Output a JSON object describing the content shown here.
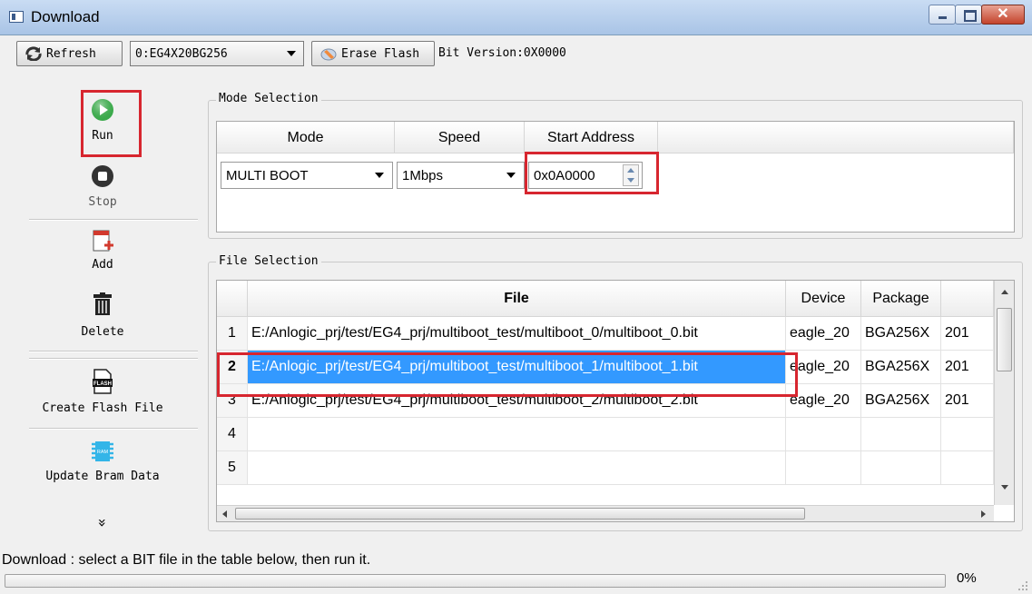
{
  "window": {
    "title": "Download"
  },
  "toolbar": {
    "refresh_label": "Refresh",
    "device_combo_value": "0:EG4X20BG256",
    "erase_label": "Erase Flash",
    "bit_version": "Bit Version:0X0000"
  },
  "sidebar": {
    "run": "Run",
    "stop": "Stop",
    "add": "Add",
    "delete": "Delete",
    "create_flash": "Create Flash File",
    "flash_icon_text": "FLASH",
    "update_bram": "Update Bram Data",
    "ram_icon_text": "RAM",
    "more": "»"
  },
  "mode_selection": {
    "title": "Mode Selection",
    "headers": {
      "mode": "Mode",
      "speed": "Speed",
      "start_address": "Start Address"
    },
    "mode_value": "MULTI BOOT",
    "speed_value": "1Mbps",
    "address_value": "0x0A0000"
  },
  "file_selection": {
    "title": "File Selection",
    "headers": {
      "file": "File",
      "device": "Device",
      "package": "Package",
      "extra": ""
    },
    "rows": [
      {
        "n": "1",
        "file": "E:/Anlogic_prj/test/EG4_prj/multiboot_test/multiboot_0/multiboot_0.bit",
        "device": "eagle_20",
        "package": "BGA256X",
        "extra": "201"
      },
      {
        "n": "2",
        "file": "E:/Anlogic_prj/test/EG4_prj/multiboot_test/multiboot_1/multiboot_1.bit",
        "device": "eagle_20",
        "package": "BGA256X",
        "extra": "201"
      },
      {
        "n": "3",
        "file": "E:/Anlogic_prj/test/EG4_prj/multiboot_test/multiboot_2/multiboot_2.bit",
        "device": "eagle_20",
        "package": "BGA256X",
        "extra": "201"
      },
      {
        "n": "4",
        "file": "",
        "device": "",
        "package": "",
        "extra": ""
      },
      {
        "n": "5",
        "file": "",
        "device": "",
        "package": "",
        "extra": ""
      }
    ]
  },
  "status": {
    "message": "Download : select a BIT file in the table below, then run it.",
    "progress_fraction": 0,
    "progress_label": "0%"
  },
  "colors": {
    "highlight_box": "#d7262f",
    "selection": "#3399ff",
    "run_icon": "#3aa94a"
  }
}
